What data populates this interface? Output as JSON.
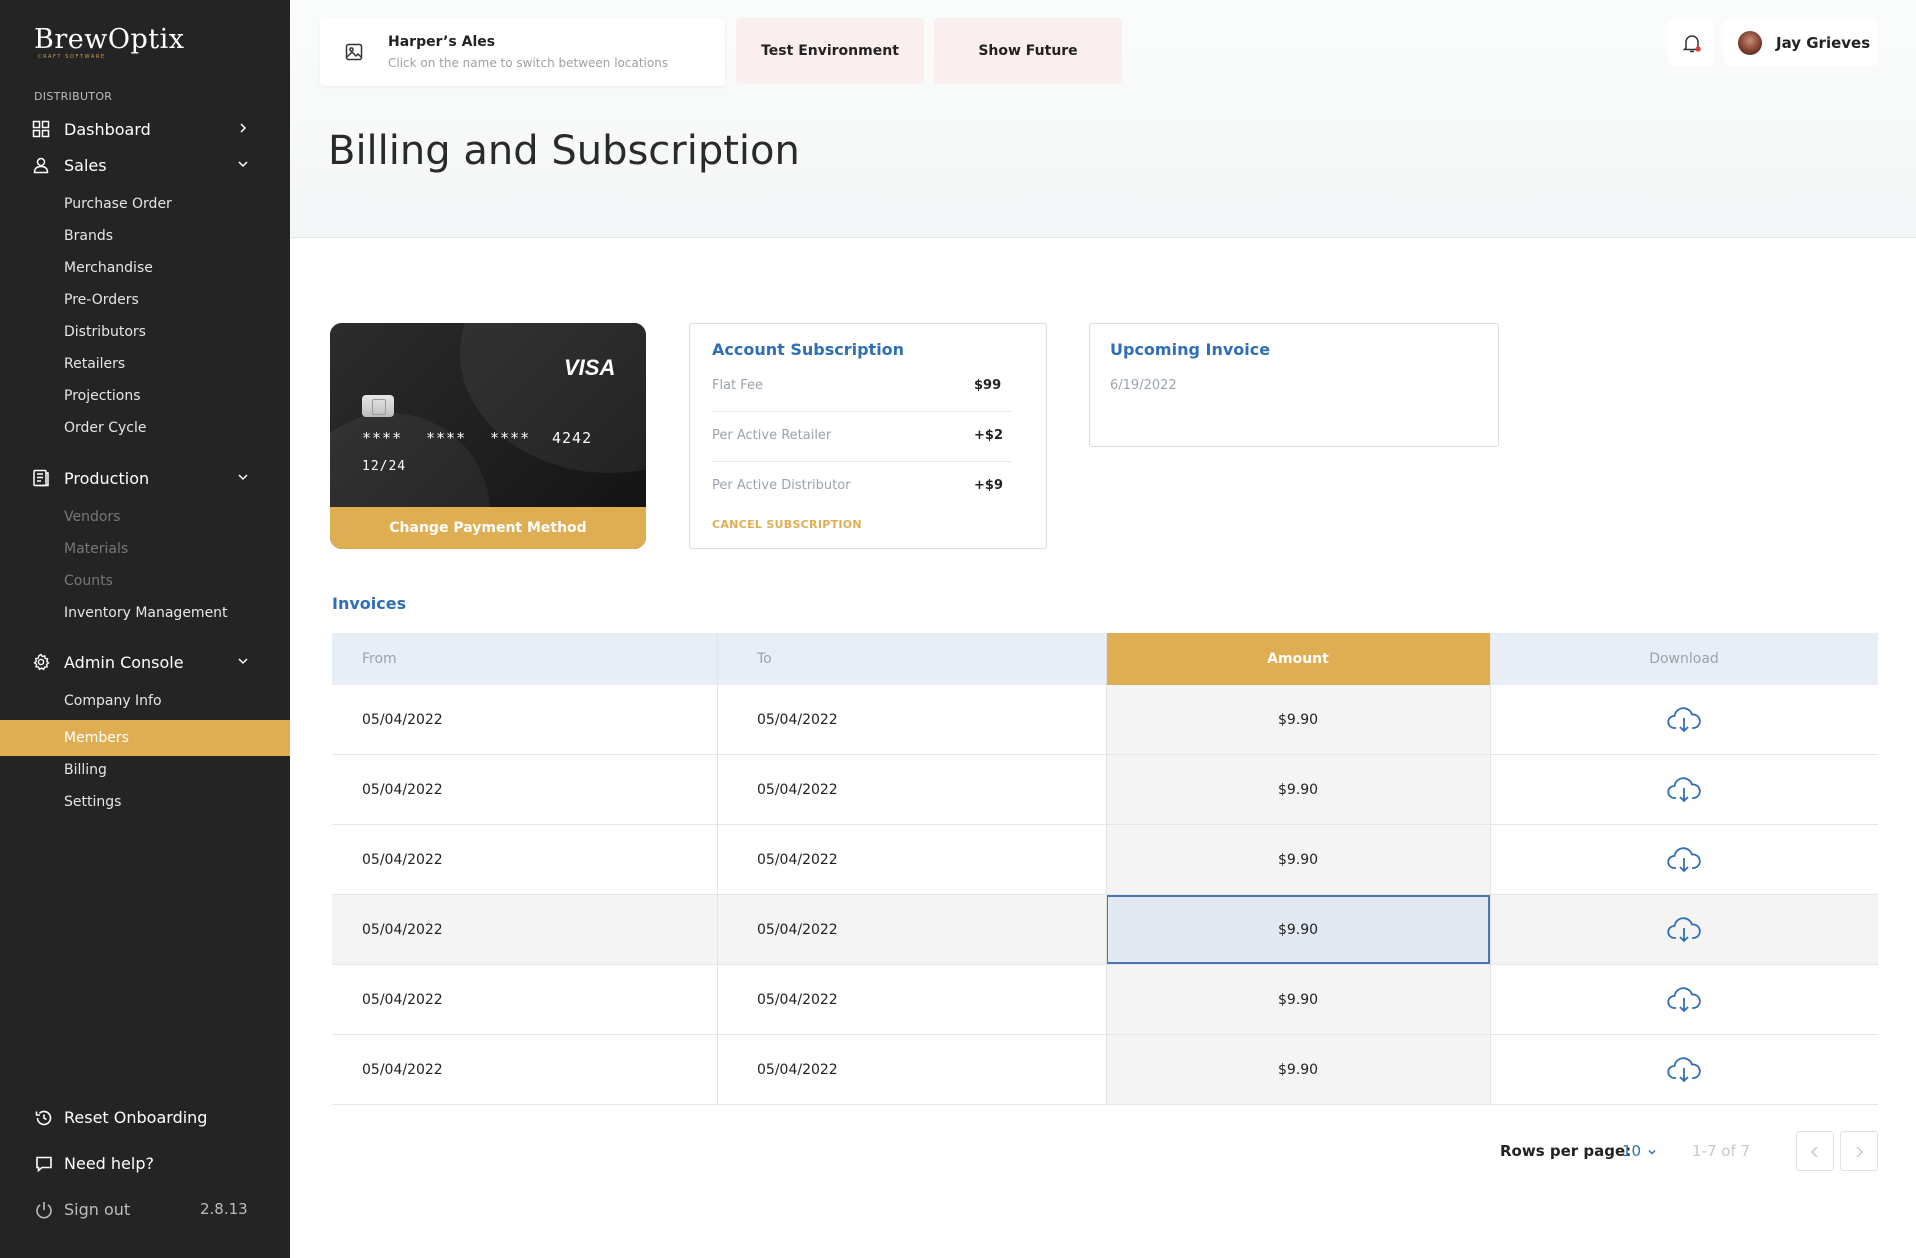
{
  "sidebar": {
    "logo": "BrewOptix",
    "logo_tagline": "CRAFT SOFTWARE",
    "section_label": "DISTRIBUTOR",
    "dashboard": "Dashboard",
    "sales": {
      "label": "Sales",
      "items": [
        "Purchase Order",
        "Brands",
        "Merchandise",
        "Pre-Orders",
        "Distributors",
        "Retailers",
        "Projections",
        "Order Cycle"
      ]
    },
    "production": {
      "label": "Production",
      "items": [
        "Vendors",
        "Materials",
        "Counts",
        "Inventory Management"
      ]
    },
    "admin": {
      "label": "Admin Console",
      "items": [
        "Company Info",
        "Members",
        "Billing",
        "Settings"
      ],
      "active_item": "Members"
    },
    "reset_onboarding": "Reset Onboarding",
    "need_help": "Need help?",
    "sign_out": "Sign out",
    "version": "2.8.13"
  },
  "header": {
    "location_name": "Harper’s Ales",
    "location_hint": "Click on the name to switch between locations",
    "test_env": "Test Environment",
    "show_future": "Show Future",
    "user_name": "Jay Grieves"
  },
  "page": {
    "title": "Billing and Subscription"
  },
  "card": {
    "brand": "VISA",
    "group1": "****",
    "group2": "****",
    "group3": "****",
    "last4": "4242",
    "expiry": "12/24",
    "change_label": "Change Payment Method"
  },
  "subscription": {
    "title": "Account Subscription",
    "rows": [
      {
        "label": "Flat Fee",
        "value": "$99"
      },
      {
        "label": "Per Active  Retailer",
        "value": "+$2"
      },
      {
        "label": "Per Active  Distributor",
        "value": "+$9"
      }
    ],
    "cancel_label": "CANCEL SUBSCRIPTION"
  },
  "upcoming": {
    "title": "Upcoming Invoice",
    "date": "6/19/2022"
  },
  "invoices": {
    "title": "Invoices",
    "columns": {
      "from": "From",
      "to": "To",
      "amount": "Amount",
      "download": "Download"
    },
    "rows": [
      {
        "from": "05/04/2022",
        "to": "05/04/2022",
        "amount": "$9.90"
      },
      {
        "from": "05/04/2022",
        "to": "05/04/2022",
        "amount": "$9.90"
      },
      {
        "from": "05/04/2022",
        "to": "05/04/2022",
        "amount": "$9.90"
      },
      {
        "from": "05/04/2022",
        "to": "05/04/2022",
        "amount": "$9.90"
      },
      {
        "from": "05/04/2022",
        "to": "05/04/2022",
        "amount": "$9.90"
      },
      {
        "from": "05/04/2022",
        "to": "05/04/2022",
        "amount": "$9.90"
      }
    ]
  },
  "pagination": {
    "rows_per_page_label": "Rows per page:",
    "rows_per_page": "10",
    "range": "1-7 of 7"
  },
  "colors": {
    "accent": "#e0ae52",
    "link": "#2f6fb5",
    "sidebar": "#242424",
    "alert_dot": "#e53935"
  }
}
